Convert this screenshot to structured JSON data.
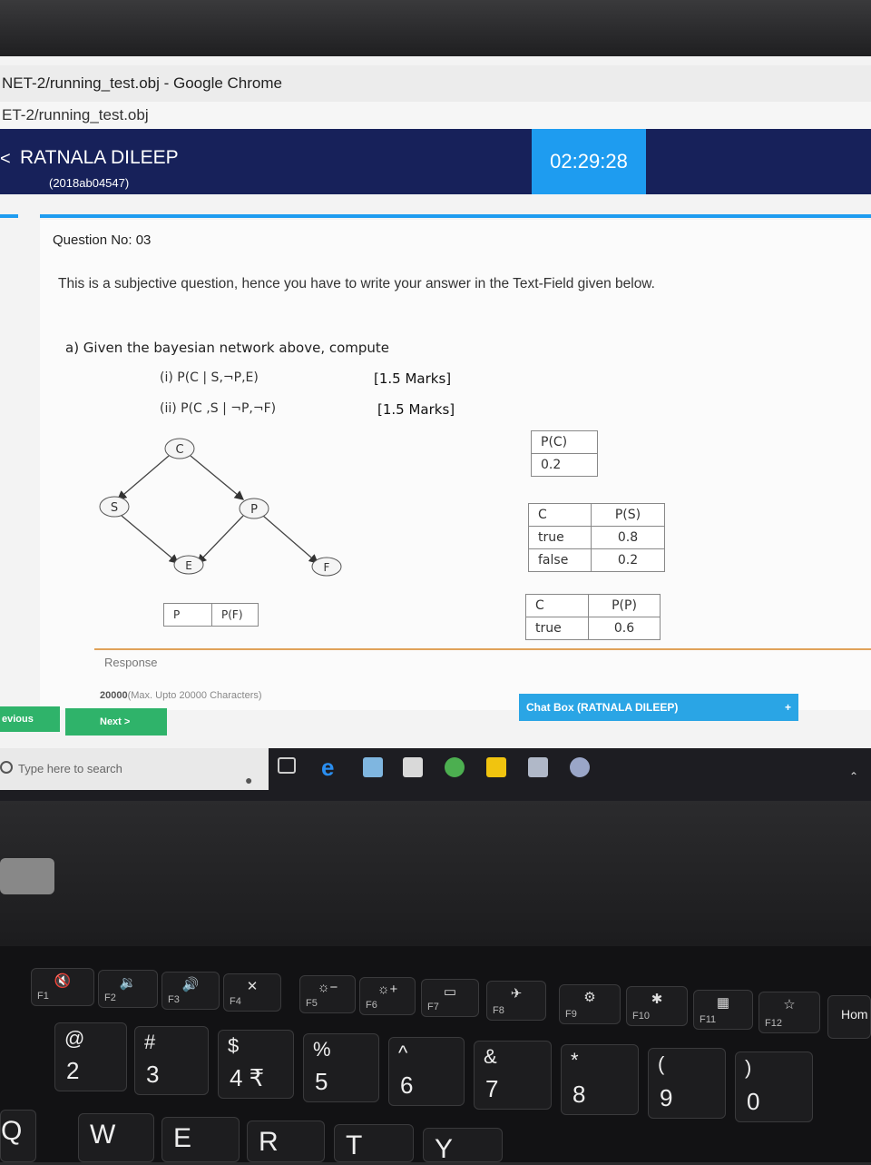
{
  "browser": {
    "title": "NET-2/running_test.obj - Google Chrome",
    "url": "ET-2/running_test.obj"
  },
  "header": {
    "back_chevron": "<",
    "user_name": "RATNALA DILEEP",
    "user_id": "(2018ab04547)",
    "timer": "02:29:28"
  },
  "question": {
    "number_label": "Question No: 03",
    "instruction": "This is a subjective question, hence you have to write your answer in the Text-Field given below.",
    "intro": "a) Given the bayesian network above, compute",
    "parts": [
      {
        "text": "(i)  P(C | S,¬P,E)",
        "marks": "[1.5 Marks]"
      },
      {
        "text": "(ii) P(C ,S | ¬P,¬F)",
        "marks": "[1.5 Marks]"
      }
    ],
    "network": {
      "nodes": [
        {
          "id": "C",
          "label": "C"
        },
        {
          "id": "S",
          "label": "S"
        },
        {
          "id": "P",
          "label": "P"
        },
        {
          "id": "E",
          "label": "E"
        },
        {
          "id": "F",
          "label": "F"
        }
      ],
      "edges": [
        [
          "C",
          "S"
        ],
        [
          "C",
          "P"
        ],
        [
          "S",
          "E"
        ],
        [
          "P",
          "E"
        ],
        [
          "P",
          "F"
        ]
      ]
    },
    "tables": {
      "pc": {
        "header": "P(C)",
        "value": "0.2"
      },
      "ps": {
        "headers": [
          "C",
          "P(S)"
        ],
        "rows": [
          [
            "true",
            "0.8"
          ],
          [
            "false",
            "0.2"
          ]
        ]
      },
      "pp": {
        "headers": [
          "C",
          "P(P)"
        ],
        "rows": [
          [
            "true",
            "0.6"
          ]
        ]
      },
      "pf": {
        "headers": [
          "P",
          "P(F)"
        ]
      }
    }
  },
  "response": {
    "label": "Response",
    "char_count": "20000",
    "char_note": "(Max. Upto 20000 Characters)"
  },
  "buttons": {
    "previous": "evious",
    "next": "Next >"
  },
  "chat": {
    "label": "Chat Box (RATNALA DILEEP)",
    "toggle": "+"
  },
  "taskbar": {
    "search_placeholder": "Type here to search"
  },
  "keyboard": {
    "fkeys": [
      {
        "label": "F1",
        "icon": "🔇"
      },
      {
        "label": "F2",
        "icon": "🔉"
      },
      {
        "label": "F3",
        "icon": "🔊"
      },
      {
        "label": "F4",
        "icon": "✕"
      },
      {
        "label": "F5",
        "icon": "☼−"
      },
      {
        "label": "F6",
        "icon": "☼+"
      },
      {
        "label": "F7",
        "icon": "▭"
      },
      {
        "label": "F8",
        "icon": "✈"
      },
      {
        "label": "F9",
        "icon": "⚙"
      },
      {
        "label": "F10",
        "icon": "✱"
      },
      {
        "label": "F11",
        "icon": "▦"
      },
      {
        "label": "F12",
        "icon": "☆"
      }
    ],
    "home": "Hom",
    "numkeys": [
      {
        "top": "@",
        "bottom": "2"
      },
      {
        "top": "#",
        "bottom": "3"
      },
      {
        "top": "$",
        "bottom": "4 ₹"
      },
      {
        "top": "%",
        "bottom": "5"
      },
      {
        "top": "^",
        "bottom": "6"
      },
      {
        "top": "&",
        "bottom": "7"
      },
      {
        "top": "*",
        "bottom": "8"
      },
      {
        "top": "(",
        "bottom": "9"
      },
      {
        "top": ")",
        "bottom": "0"
      }
    ],
    "letters": [
      "Q",
      "W",
      "E",
      "R",
      "T",
      "Y"
    ]
  }
}
